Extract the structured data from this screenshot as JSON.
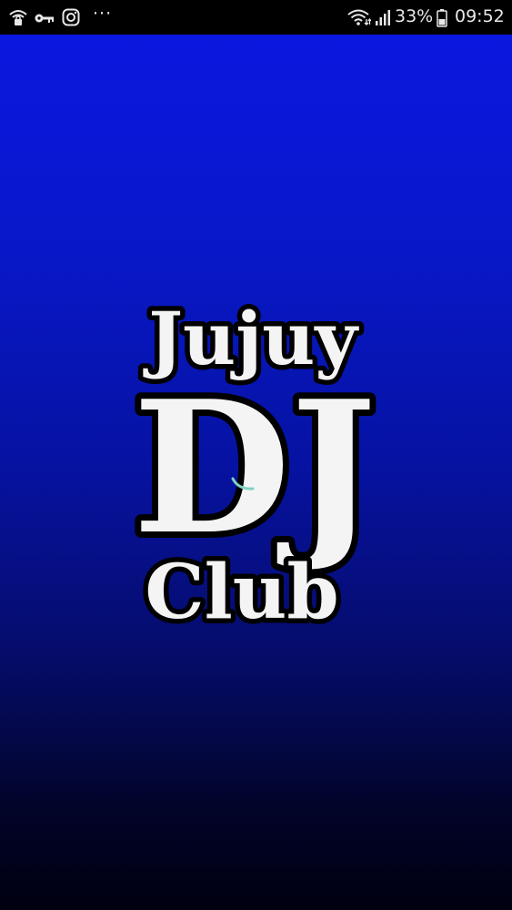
{
  "status_bar": {
    "battery_percent": "33%",
    "time": "09:52",
    "more_indicator": "···",
    "icons": [
      "wifi-lock-icon",
      "key-icon",
      "instagram-icon",
      "more-icon",
      "wifi-icon",
      "signal-icon",
      "battery-icon"
    ],
    "text_color": "#e8e8e8"
  },
  "splash": {
    "logo": {
      "line1": "Jujuy",
      "line2": "DJ",
      "line3": "Club"
    },
    "background_top": "#0a18e0",
    "background_bottom": "#000010",
    "spinner_color": "#7fd1c0"
  }
}
